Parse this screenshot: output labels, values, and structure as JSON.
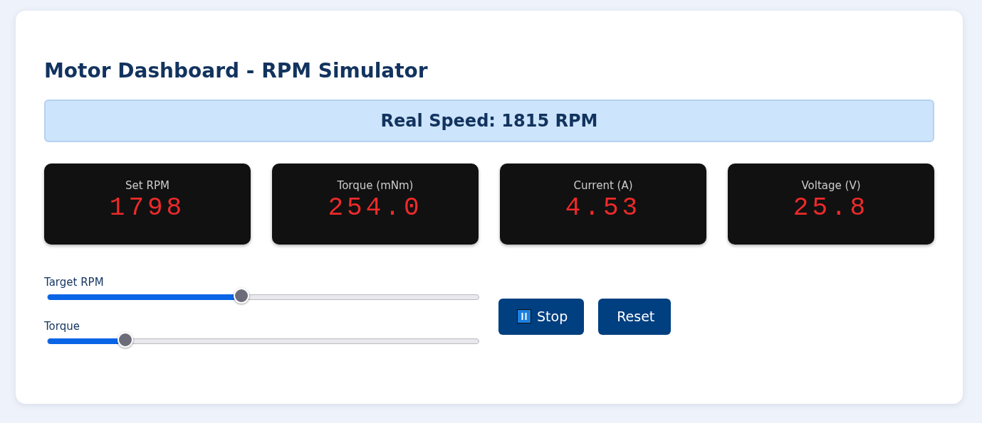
{
  "title": "Motor Dashboard - RPM Simulator",
  "banner": {
    "label": "Real Speed: 1815 RPM"
  },
  "metrics": [
    {
      "label": "Set RPM",
      "value": "1798"
    },
    {
      "label": "Torque (mNm)",
      "value": "254.0"
    },
    {
      "label": "Current (A)",
      "value": "4.53"
    },
    {
      "label": "Voltage (V)",
      "value": "25.8"
    }
  ],
  "sliders": [
    {
      "label": "Target RPM",
      "level": 0.45
    },
    {
      "label": "Torque",
      "level": 0.18
    }
  ],
  "buttons": [
    {
      "kind": "pause",
      "label": "Stop"
    },
    {
      "kind": "plain",
      "label": "Reset"
    }
  ]
}
